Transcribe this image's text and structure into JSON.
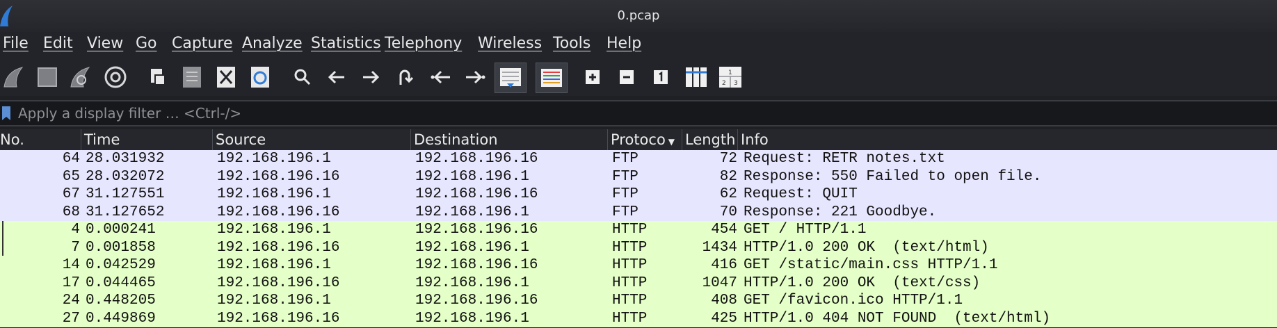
{
  "window": {
    "title": "0.pcap"
  },
  "menu": [
    "File",
    "Edit",
    "View",
    "Go",
    "Capture",
    "Analyze",
    "Statistics",
    "Telephony",
    "Wireless",
    "Tools",
    "Help"
  ],
  "toolbar": [
    {
      "name": "start-capture-icon"
    },
    {
      "name": "stop-capture-icon"
    },
    {
      "name": "restart-capture-icon"
    },
    {
      "name": "capture-options-icon"
    },
    {
      "name": "open-file-icon"
    },
    {
      "name": "save-file-icon"
    },
    {
      "name": "close-file-icon"
    },
    {
      "name": "reload-file-icon"
    },
    {
      "name": "find-packet-icon"
    },
    {
      "name": "go-back-icon"
    },
    {
      "name": "go-forward-icon"
    },
    {
      "name": "go-to-packet-icon"
    },
    {
      "name": "first-packet-icon"
    },
    {
      "name": "last-packet-icon"
    },
    {
      "name": "autoscroll-icon"
    },
    {
      "name": "colorize-icon"
    },
    {
      "name": "zoom-in-icon"
    },
    {
      "name": "zoom-out-icon"
    },
    {
      "name": "normal-size-icon"
    },
    {
      "name": "resize-columns-icon"
    },
    {
      "name": "layout-icon"
    }
  ],
  "filter": {
    "placeholder": "Apply a display filter … <Ctrl-/>"
  },
  "columns": [
    "No.",
    "Time",
    "Source",
    "Destination",
    "Protoco",
    "Length",
    "Info"
  ],
  "rows": [
    {
      "no": "64",
      "time": "28.031932",
      "src": "192.168.196.1",
      "dst": "192.168.196.16",
      "proto": "FTP",
      "len": "72",
      "info": "Request: RETR notes.txt"
    },
    {
      "no": "65",
      "time": "28.032072",
      "src": "192.168.196.16",
      "dst": "192.168.196.1",
      "proto": "FTP",
      "len": "82",
      "info": "Response: 550 Failed to open file."
    },
    {
      "no": "67",
      "time": "31.127551",
      "src": "192.168.196.1",
      "dst": "192.168.196.16",
      "proto": "FTP",
      "len": "62",
      "info": "Request: QUIT"
    },
    {
      "no": "68",
      "time": "31.127652",
      "src": "192.168.196.16",
      "dst": "192.168.196.1",
      "proto": "FTP",
      "len": "70",
      "info": "Response: 221 Goodbye."
    },
    {
      "no": "4",
      "time": "0.000241",
      "src": "192.168.196.1",
      "dst": "192.168.196.16",
      "proto": "HTTP",
      "len": "454",
      "info": "GET / HTTP/1.1"
    },
    {
      "no": "7",
      "time": "0.001858",
      "src": "192.168.196.16",
      "dst": "192.168.196.1",
      "proto": "HTTP",
      "len": "1434",
      "info": "HTTP/1.0 200 OK  (text/html)"
    },
    {
      "no": "14",
      "time": "0.042529",
      "src": "192.168.196.1",
      "dst": "192.168.196.16",
      "proto": "HTTP",
      "len": "416",
      "info": "GET /static/main.css HTTP/1.1"
    },
    {
      "no": "17",
      "time": "0.044465",
      "src": "192.168.196.16",
      "dst": "192.168.196.1",
      "proto": "HTTP",
      "len": "1047",
      "info": "HTTP/1.0 200 OK  (text/css)"
    },
    {
      "no": "24",
      "time": "0.448205",
      "src": "192.168.196.1",
      "dst": "192.168.196.16",
      "proto": "HTTP",
      "len": "408",
      "info": "GET /favicon.ico HTTP/1.1"
    },
    {
      "no": "27",
      "time": "0.449869",
      "src": "192.168.196.16",
      "dst": "192.168.196.1",
      "proto": "HTTP",
      "len": "425",
      "info": "HTTP/1.0 404 NOT FOUND  (text/html)"
    }
  ],
  "colors": {
    "ftp_row": "#e7e6ff",
    "http_row": "#e4ffc7",
    "accent": "#2f7bd6"
  }
}
